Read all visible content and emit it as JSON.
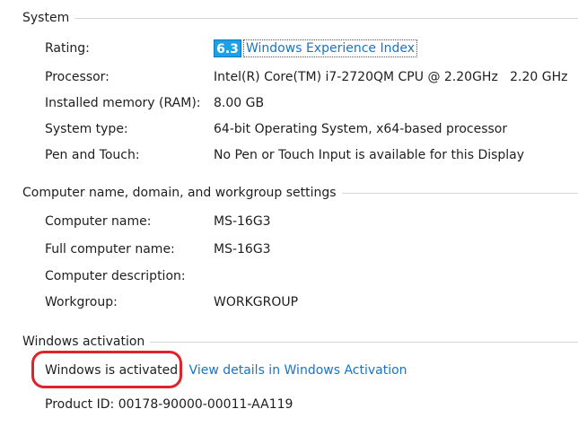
{
  "system": {
    "title": "System",
    "rows": [
      {
        "label": "Rating:",
        "badge": "6.3",
        "link": "Windows Experience Index"
      },
      {
        "label": "Processor:",
        "value": "Intel(R) Core(TM) i7-2720QM CPU @ 2.20GHz   2.20 GHz"
      },
      {
        "label": "Installed memory (RAM):",
        "value": "8.00 GB"
      },
      {
        "label": "System type:",
        "value": "64-bit Operating System, x64-based processor"
      },
      {
        "label": "Pen and Touch:",
        "value": "No Pen or Touch Input is available for this Display"
      }
    ]
  },
  "computer": {
    "title": "Computer name, domain, and workgroup settings",
    "rows": [
      {
        "label": "Computer name:",
        "value": "MS-16G3"
      },
      {
        "label": "Full computer name:",
        "value": "MS-16G3"
      },
      {
        "label": "Computer description:",
        "value": ""
      },
      {
        "label": "Workgroup:",
        "value": "WORKGROUP"
      }
    ]
  },
  "activation": {
    "title": "Windows activation",
    "status": "Windows is activated",
    "link": "View details in Windows Activation",
    "product_id_label": "Product ID:",
    "product_id": "00178-90000-00011-AA119"
  },
  "colors": {
    "badge_bg": "#1ea0e6",
    "link": "#1a73c9",
    "highlight_circle": "#e0222c"
  }
}
